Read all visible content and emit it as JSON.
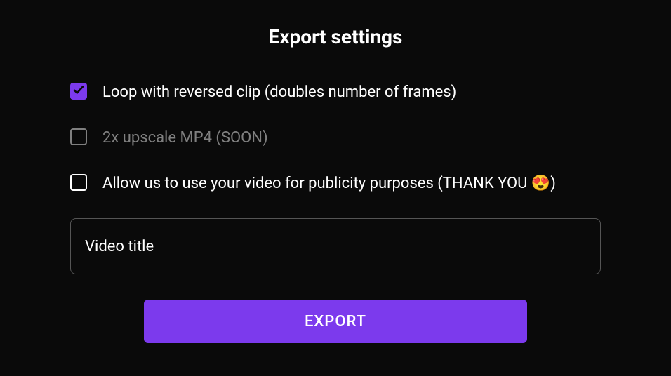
{
  "title": "Export settings",
  "options": {
    "loop": {
      "label": "Loop with reversed clip (doubles number of frames)",
      "checked": true,
      "disabled": false
    },
    "upscale": {
      "label": "2x upscale MP4 (SOON)",
      "checked": false,
      "disabled": true
    },
    "publicity": {
      "label": "Allow us to use your video for publicity purposes (THANK YOU 😍)",
      "checked": false,
      "disabled": false
    }
  },
  "input": {
    "placeholder": "Video title",
    "value": ""
  },
  "button": {
    "label": "EXPORT"
  },
  "colors": {
    "accent": "#7c3aed",
    "background": "#0a0a0a",
    "text": "#ffffff",
    "disabled": "#808080",
    "border": "#555555"
  }
}
